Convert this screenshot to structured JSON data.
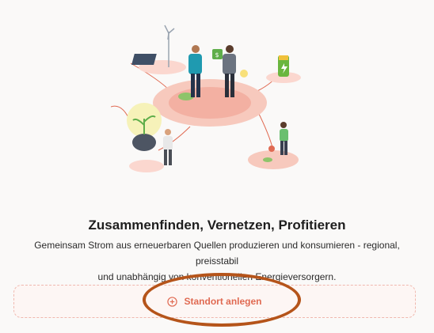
{
  "hero": {
    "title": "Zusammenfinden, Vernetzen, Profitieren",
    "subtitle_line1": "Gemeinsam Strom aus erneuerbaren Quellen produzieren und konsumieren - regional, preisstabil",
    "subtitle_line2": "und unabhängig von konventionellen Energieversorgern."
  },
  "action": {
    "add_location_label": "Standort anlegen",
    "icon": "plus-circle-icon"
  },
  "colors": {
    "accent": "#e06a52",
    "accent_soft": "#f7c9bd",
    "highlight": "#b5541a"
  }
}
